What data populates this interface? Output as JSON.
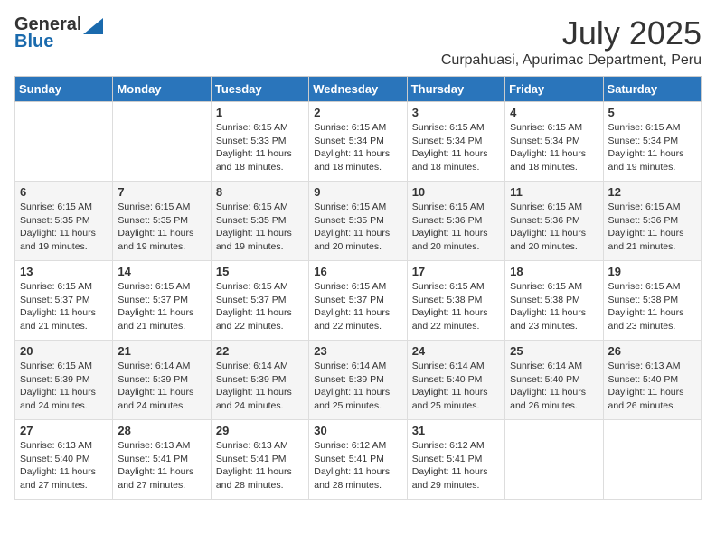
{
  "header": {
    "logo_general": "General",
    "logo_blue": "Blue",
    "month_title": "July 2025",
    "subtitle": "Curpahuasi, Apurimac Department, Peru"
  },
  "days_of_week": [
    "Sunday",
    "Monday",
    "Tuesday",
    "Wednesday",
    "Thursday",
    "Friday",
    "Saturday"
  ],
  "weeks": [
    [
      {
        "day": "",
        "sunrise": "",
        "sunset": "",
        "daylight": ""
      },
      {
        "day": "",
        "sunrise": "",
        "sunset": "",
        "daylight": ""
      },
      {
        "day": "1",
        "sunrise": "Sunrise: 6:15 AM",
        "sunset": "Sunset: 5:33 PM",
        "daylight": "Daylight: 11 hours and 18 minutes."
      },
      {
        "day": "2",
        "sunrise": "Sunrise: 6:15 AM",
        "sunset": "Sunset: 5:34 PM",
        "daylight": "Daylight: 11 hours and 18 minutes."
      },
      {
        "day": "3",
        "sunrise": "Sunrise: 6:15 AM",
        "sunset": "Sunset: 5:34 PM",
        "daylight": "Daylight: 11 hours and 18 minutes."
      },
      {
        "day": "4",
        "sunrise": "Sunrise: 6:15 AM",
        "sunset": "Sunset: 5:34 PM",
        "daylight": "Daylight: 11 hours and 18 minutes."
      },
      {
        "day": "5",
        "sunrise": "Sunrise: 6:15 AM",
        "sunset": "Sunset: 5:34 PM",
        "daylight": "Daylight: 11 hours and 19 minutes."
      }
    ],
    [
      {
        "day": "6",
        "sunrise": "Sunrise: 6:15 AM",
        "sunset": "Sunset: 5:35 PM",
        "daylight": "Daylight: 11 hours and 19 minutes."
      },
      {
        "day": "7",
        "sunrise": "Sunrise: 6:15 AM",
        "sunset": "Sunset: 5:35 PM",
        "daylight": "Daylight: 11 hours and 19 minutes."
      },
      {
        "day": "8",
        "sunrise": "Sunrise: 6:15 AM",
        "sunset": "Sunset: 5:35 PM",
        "daylight": "Daylight: 11 hours and 19 minutes."
      },
      {
        "day": "9",
        "sunrise": "Sunrise: 6:15 AM",
        "sunset": "Sunset: 5:35 PM",
        "daylight": "Daylight: 11 hours and 20 minutes."
      },
      {
        "day": "10",
        "sunrise": "Sunrise: 6:15 AM",
        "sunset": "Sunset: 5:36 PM",
        "daylight": "Daylight: 11 hours and 20 minutes."
      },
      {
        "day": "11",
        "sunrise": "Sunrise: 6:15 AM",
        "sunset": "Sunset: 5:36 PM",
        "daylight": "Daylight: 11 hours and 20 minutes."
      },
      {
        "day": "12",
        "sunrise": "Sunrise: 6:15 AM",
        "sunset": "Sunset: 5:36 PM",
        "daylight": "Daylight: 11 hours and 21 minutes."
      }
    ],
    [
      {
        "day": "13",
        "sunrise": "Sunrise: 6:15 AM",
        "sunset": "Sunset: 5:37 PM",
        "daylight": "Daylight: 11 hours and 21 minutes."
      },
      {
        "day": "14",
        "sunrise": "Sunrise: 6:15 AM",
        "sunset": "Sunset: 5:37 PM",
        "daylight": "Daylight: 11 hours and 21 minutes."
      },
      {
        "day": "15",
        "sunrise": "Sunrise: 6:15 AM",
        "sunset": "Sunset: 5:37 PM",
        "daylight": "Daylight: 11 hours and 22 minutes."
      },
      {
        "day": "16",
        "sunrise": "Sunrise: 6:15 AM",
        "sunset": "Sunset: 5:37 PM",
        "daylight": "Daylight: 11 hours and 22 minutes."
      },
      {
        "day": "17",
        "sunrise": "Sunrise: 6:15 AM",
        "sunset": "Sunset: 5:38 PM",
        "daylight": "Daylight: 11 hours and 22 minutes."
      },
      {
        "day": "18",
        "sunrise": "Sunrise: 6:15 AM",
        "sunset": "Sunset: 5:38 PM",
        "daylight": "Daylight: 11 hours and 23 minutes."
      },
      {
        "day": "19",
        "sunrise": "Sunrise: 6:15 AM",
        "sunset": "Sunset: 5:38 PM",
        "daylight": "Daylight: 11 hours and 23 minutes."
      }
    ],
    [
      {
        "day": "20",
        "sunrise": "Sunrise: 6:15 AM",
        "sunset": "Sunset: 5:39 PM",
        "daylight": "Daylight: 11 hours and 24 minutes."
      },
      {
        "day": "21",
        "sunrise": "Sunrise: 6:14 AM",
        "sunset": "Sunset: 5:39 PM",
        "daylight": "Daylight: 11 hours and 24 minutes."
      },
      {
        "day": "22",
        "sunrise": "Sunrise: 6:14 AM",
        "sunset": "Sunset: 5:39 PM",
        "daylight": "Daylight: 11 hours and 24 minutes."
      },
      {
        "day": "23",
        "sunrise": "Sunrise: 6:14 AM",
        "sunset": "Sunset: 5:39 PM",
        "daylight": "Daylight: 11 hours and 25 minutes."
      },
      {
        "day": "24",
        "sunrise": "Sunrise: 6:14 AM",
        "sunset": "Sunset: 5:40 PM",
        "daylight": "Daylight: 11 hours and 25 minutes."
      },
      {
        "day": "25",
        "sunrise": "Sunrise: 6:14 AM",
        "sunset": "Sunset: 5:40 PM",
        "daylight": "Daylight: 11 hours and 26 minutes."
      },
      {
        "day": "26",
        "sunrise": "Sunrise: 6:13 AM",
        "sunset": "Sunset: 5:40 PM",
        "daylight": "Daylight: 11 hours and 26 minutes."
      }
    ],
    [
      {
        "day": "27",
        "sunrise": "Sunrise: 6:13 AM",
        "sunset": "Sunset: 5:40 PM",
        "daylight": "Daylight: 11 hours and 27 minutes."
      },
      {
        "day": "28",
        "sunrise": "Sunrise: 6:13 AM",
        "sunset": "Sunset: 5:41 PM",
        "daylight": "Daylight: 11 hours and 27 minutes."
      },
      {
        "day": "29",
        "sunrise": "Sunrise: 6:13 AM",
        "sunset": "Sunset: 5:41 PM",
        "daylight": "Daylight: 11 hours and 28 minutes."
      },
      {
        "day": "30",
        "sunrise": "Sunrise: 6:12 AM",
        "sunset": "Sunset: 5:41 PM",
        "daylight": "Daylight: 11 hours and 28 minutes."
      },
      {
        "day": "31",
        "sunrise": "Sunrise: 6:12 AM",
        "sunset": "Sunset: 5:41 PM",
        "daylight": "Daylight: 11 hours and 29 minutes."
      },
      {
        "day": "",
        "sunrise": "",
        "sunset": "",
        "daylight": ""
      },
      {
        "day": "",
        "sunrise": "",
        "sunset": "",
        "daylight": ""
      }
    ]
  ]
}
